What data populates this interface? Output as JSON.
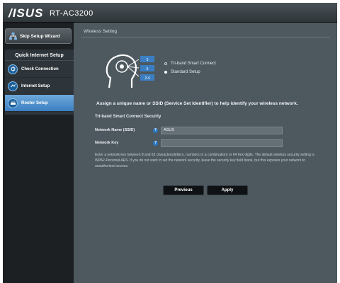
{
  "header": {
    "brand": "/ISUS",
    "model": "RT-AC3200"
  },
  "sidebar": {
    "skip_label": "Skip Setup Wizard",
    "menu_title": "Quick Internet Setup",
    "items": [
      {
        "label": "Check Connection",
        "icon": "connection-step-icon"
      },
      {
        "label": "Internet Setup",
        "icon": "internet-step-icon"
      },
      {
        "label": "Router Setup",
        "icon": "router-step-icon",
        "active": true
      }
    ]
  },
  "main": {
    "title": "Wireless Setting",
    "diagram_bands": [
      "5",
      "5",
      "2.4"
    ],
    "modes": [
      {
        "label": "Tri-band Smart Connect",
        "selected": false
      },
      {
        "label": "Standard Setup",
        "selected": true
      }
    ],
    "assign_text": "Assign a unique name or SSID (Service Set Identifier) to help identify your wireless network.",
    "section_title": "Tri-band Smart Connect Security",
    "fields": {
      "network_name_label": "Network Name (SSID)",
      "network_name_value": "ASUS",
      "network_key_label": "Network Key",
      "network_key_value": ""
    },
    "note": "Enter a network key between 8 and 63 characters(letters, numbers or a combination) or 64 hex digits. The default wireless security setting is WPA2-Personal AES. If you do not want to set the network security, leave the security key field blank, but this exposes your network to unauthorized access.",
    "buttons": {
      "previous": "Previous",
      "apply": "Apply"
    }
  },
  "colors": {
    "accent": "#3b7fc2",
    "panel": "#4d585f",
    "sidebar": "#1c2023",
    "button": "#0f1214"
  }
}
